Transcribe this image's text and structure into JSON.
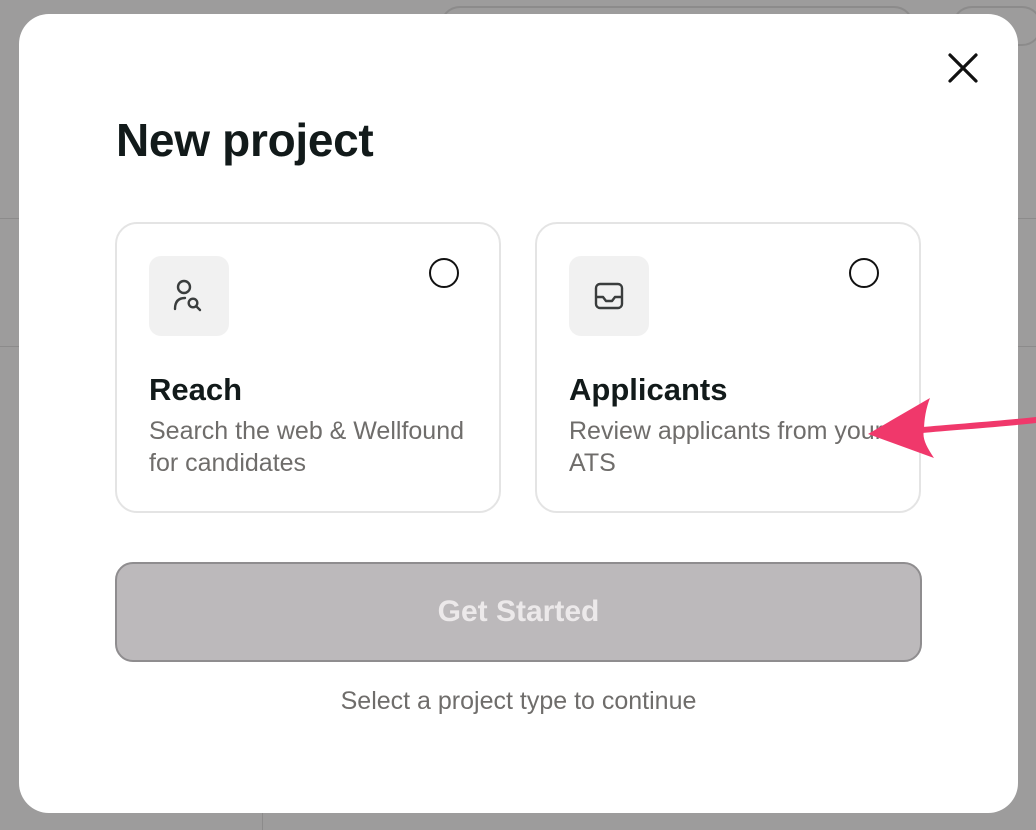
{
  "modal": {
    "title": "New project",
    "close_icon": "close-icon"
  },
  "cards": [
    {
      "icon": "user-search-icon",
      "title": "Reach",
      "description": "Search the web & Wellfound for candidates",
      "selected": false
    },
    {
      "icon": "inbox-icon",
      "title": "Applicants",
      "description": "Review applicants from your ATS",
      "selected": false
    }
  ],
  "cta": {
    "label": "Get Started",
    "disabled": true
  },
  "hint": "Select a project type to continue",
  "annotation": {
    "icon": "arrow-left-icon",
    "color": "#f0386b"
  },
  "colors": {
    "overlay": "#9d9c9c",
    "title_text": "#121a1a",
    "muted_text": "#6f6d6b",
    "button_disabled_bg": "#bcb9bb"
  }
}
